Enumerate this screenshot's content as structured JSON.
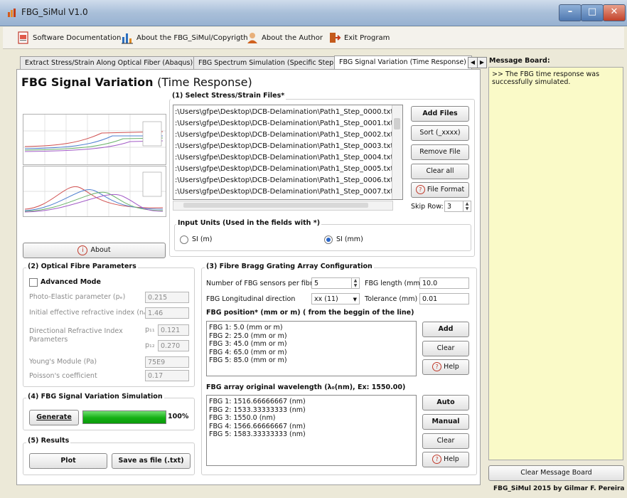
{
  "window": {
    "title": "FBG_SiMul V1.0",
    "minimize": "–",
    "maximize": "□",
    "close": "✕"
  },
  "toolbar": {
    "documentation": "Software Documentation",
    "about_copyright": "About the FBG_SiMul/Copyrigth",
    "about_author": "About the Author",
    "exit": "Exit Program"
  },
  "tabs": [
    {
      "label": "Extract Stress/Strain Along Optical Fiber (Abaqus)"
    },
    {
      "label": "FBG Spectrum Simulation (Specific Step)"
    },
    {
      "label": "FBG Signal Variation (Time Response)"
    }
  ],
  "tab_nav": {
    "prev": "◀",
    "next": "▶"
  },
  "main": {
    "title_bold": "FBG Signal Variation",
    "title_normal": "(Time Response)"
  },
  "select_files": {
    "label": "(1) Select Stress/Strain Files*",
    "files": [
      ":\\Users\\gfpe\\Desktop\\DCB-Delamination\\Path1_Step_0000.txt",
      ":\\Users\\gfpe\\Desktop\\DCB-Delamination\\Path1_Step_0001.txt",
      ":\\Users\\gfpe\\Desktop\\DCB-Delamination\\Path1_Step_0002.txt",
      ":\\Users\\gfpe\\Desktop\\DCB-Delamination\\Path1_Step_0003.txt",
      ":\\Users\\gfpe\\Desktop\\DCB-Delamination\\Path1_Step_0004.txt",
      ":\\Users\\gfpe\\Desktop\\DCB-Delamination\\Path1_Step_0005.txt",
      ":\\Users\\gfpe\\Desktop\\DCB-Delamination\\Path1_Step_0006.txt",
      ":\\Users\\gfpe\\Desktop\\DCB-Delamination\\Path1_Step_0007.txt"
    ],
    "add_files": "Add Files",
    "sort": "Sort (_xxxx)",
    "remove_file": "Remove File",
    "clear_all": "Clear all",
    "file_format": "File Format",
    "skip_row_label": "Skip Row:",
    "skip_row_value": "3",
    "input_units_label": "Input Units  (Used in the fields with *)",
    "unit_m": "SI (m)",
    "unit_mm": "SI (mm)"
  },
  "about_button": "About",
  "optical": {
    "label": "(2) Optical Fibre Parameters",
    "advanced_mode": "Advanced Mode",
    "photo_elastic_label": "Photo-Elastic parameter (pₑ)",
    "photo_elastic_value": "0.215",
    "n_eff_label": "Initial effective refractive index (nₑₒₒ)",
    "n_eff_value": "1.46",
    "dri_label1": "Directional Refractive Index",
    "dri_label2": "Parameters",
    "p11_label": "p₁₁",
    "p11_value": "0.121",
    "p12_label": "p₁₂",
    "p12_value": "0.270",
    "young_label": "Young's Module (Pa)",
    "young_value": "75E9",
    "poisson_label": "Poisson's coefficient",
    "poisson_value": "0.17"
  },
  "simulation": {
    "label": "(4) FBG Signal Variation Simulation",
    "generate": "Generate",
    "progress_text": "100%",
    "progress": 1.0
  },
  "results": {
    "label": "(5) Results",
    "plot": "Plot",
    "save": "Save as file (.txt)"
  },
  "fbg_array": {
    "label": "(3) Fibre Bragg Grating Array Configuration",
    "num_sensors_label": "Number of FBG sensors per fibre",
    "num_sensors_value": "5",
    "fbg_length_label": "FBG length (mm)",
    "fbg_length_value": "10.0",
    "direction_label": "FBG Longitudinal direction",
    "direction_value": "xx (11)",
    "tolerance_label": "Tolerance (mm)",
    "tolerance_value": "0.01",
    "position_label": "FBG position* (mm or m) ( from the beggin of the line)",
    "positions": [
      "FBG 1: 5.0 (mm or m)",
      "FBG 2: 25.0 (mm or m)",
      "FBG 3: 45.0 (mm or m)",
      "FBG 4: 65.0 (mm or m)",
      "FBG 5: 85.0 (mm or m)"
    ],
    "add": "Add",
    "clear": "Clear",
    "help": "Help",
    "wavelength_label": "FBG array original wavelength (λ₀(nm), Ex: 1550.00)",
    "wavelengths": [
      "FBG 1: 1516.66666667 (nm)",
      "FBG 2: 1533.33333333 (nm)",
      "FBG 3: 1550.0 (nm)",
      "FBG 4: 1566.66666667 (nm)",
      "FBG 5: 1583.33333333 (nm)"
    ],
    "auto": "Auto",
    "manual": "Manual"
  },
  "message_board": {
    "title": "Message Board:",
    "message_line1": ">> The FBG time response was",
    "message_line2": "successfully simulated.",
    "clear": "Clear Message Board"
  },
  "footer": "FBG_SiMul 2015 by Gilmar F. Pereira",
  "colors": {
    "message_bg": "#fafac8",
    "progress": "#15b015",
    "accent": "#2a66c8"
  }
}
